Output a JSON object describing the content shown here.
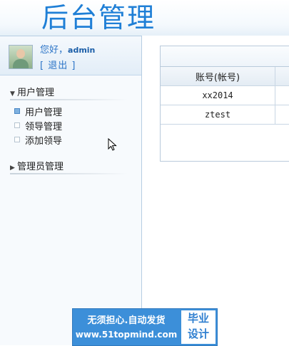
{
  "app": {
    "title": "后台管理"
  },
  "user": {
    "greeting": "您好，",
    "name": "admin",
    "logout": "[ 退出 ]"
  },
  "sidebar": {
    "groups": [
      {
        "label": "用户管理",
        "expanded": true,
        "items": [
          {
            "label": "用户管理",
            "active": true
          },
          {
            "label": "领导管理",
            "active": false
          },
          {
            "label": "添加领导",
            "active": false
          }
        ]
      },
      {
        "label": "管理员管理",
        "expanded": false
      }
    ]
  },
  "table": {
    "headers": [
      "账号(帐号)",
      ""
    ],
    "rows": [
      [
        "xx2014",
        ""
      ],
      [
        "ztest",
        ""
      ]
    ]
  },
  "watermark": {
    "line1": "无须担心.自动发货",
    "line2": "www.51topmind.com",
    "badge1": "毕业",
    "badge2": "设计"
  },
  "colors": {
    "accent": "#1f7fd6",
    "border": "#b6cde2",
    "watermark_bg": "#3c8fd9"
  }
}
